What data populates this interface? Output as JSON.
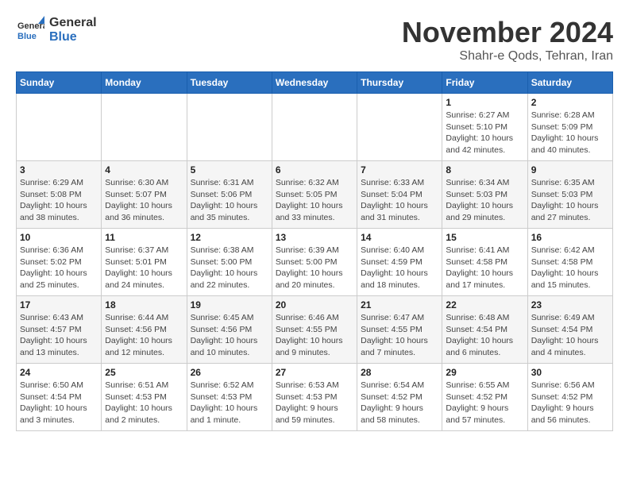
{
  "header": {
    "logo_line1": "General",
    "logo_line2": "Blue",
    "month": "November 2024",
    "location": "Shahr-e Qods, Tehran, Iran"
  },
  "weekdays": [
    "Sunday",
    "Monday",
    "Tuesday",
    "Wednesday",
    "Thursday",
    "Friday",
    "Saturday"
  ],
  "weeks": [
    [
      {
        "day": "",
        "info": ""
      },
      {
        "day": "",
        "info": ""
      },
      {
        "day": "",
        "info": ""
      },
      {
        "day": "",
        "info": ""
      },
      {
        "day": "",
        "info": ""
      },
      {
        "day": "1",
        "info": "Sunrise: 6:27 AM\nSunset: 5:10 PM\nDaylight: 10 hours\nand 42 minutes."
      },
      {
        "day": "2",
        "info": "Sunrise: 6:28 AM\nSunset: 5:09 PM\nDaylight: 10 hours\nand 40 minutes."
      }
    ],
    [
      {
        "day": "3",
        "info": "Sunrise: 6:29 AM\nSunset: 5:08 PM\nDaylight: 10 hours\nand 38 minutes."
      },
      {
        "day": "4",
        "info": "Sunrise: 6:30 AM\nSunset: 5:07 PM\nDaylight: 10 hours\nand 36 minutes."
      },
      {
        "day": "5",
        "info": "Sunrise: 6:31 AM\nSunset: 5:06 PM\nDaylight: 10 hours\nand 35 minutes."
      },
      {
        "day": "6",
        "info": "Sunrise: 6:32 AM\nSunset: 5:05 PM\nDaylight: 10 hours\nand 33 minutes."
      },
      {
        "day": "7",
        "info": "Sunrise: 6:33 AM\nSunset: 5:04 PM\nDaylight: 10 hours\nand 31 minutes."
      },
      {
        "day": "8",
        "info": "Sunrise: 6:34 AM\nSunset: 5:03 PM\nDaylight: 10 hours\nand 29 minutes."
      },
      {
        "day": "9",
        "info": "Sunrise: 6:35 AM\nSunset: 5:03 PM\nDaylight: 10 hours\nand 27 minutes."
      }
    ],
    [
      {
        "day": "10",
        "info": "Sunrise: 6:36 AM\nSunset: 5:02 PM\nDaylight: 10 hours\nand 25 minutes."
      },
      {
        "day": "11",
        "info": "Sunrise: 6:37 AM\nSunset: 5:01 PM\nDaylight: 10 hours\nand 24 minutes."
      },
      {
        "day": "12",
        "info": "Sunrise: 6:38 AM\nSunset: 5:00 PM\nDaylight: 10 hours\nand 22 minutes."
      },
      {
        "day": "13",
        "info": "Sunrise: 6:39 AM\nSunset: 5:00 PM\nDaylight: 10 hours\nand 20 minutes."
      },
      {
        "day": "14",
        "info": "Sunrise: 6:40 AM\nSunset: 4:59 PM\nDaylight: 10 hours\nand 18 minutes."
      },
      {
        "day": "15",
        "info": "Sunrise: 6:41 AM\nSunset: 4:58 PM\nDaylight: 10 hours\nand 17 minutes."
      },
      {
        "day": "16",
        "info": "Sunrise: 6:42 AM\nSunset: 4:58 PM\nDaylight: 10 hours\nand 15 minutes."
      }
    ],
    [
      {
        "day": "17",
        "info": "Sunrise: 6:43 AM\nSunset: 4:57 PM\nDaylight: 10 hours\nand 13 minutes."
      },
      {
        "day": "18",
        "info": "Sunrise: 6:44 AM\nSunset: 4:56 PM\nDaylight: 10 hours\nand 12 minutes."
      },
      {
        "day": "19",
        "info": "Sunrise: 6:45 AM\nSunset: 4:56 PM\nDaylight: 10 hours\nand 10 minutes."
      },
      {
        "day": "20",
        "info": "Sunrise: 6:46 AM\nSunset: 4:55 PM\nDaylight: 10 hours\nand 9 minutes."
      },
      {
        "day": "21",
        "info": "Sunrise: 6:47 AM\nSunset: 4:55 PM\nDaylight: 10 hours\nand 7 minutes."
      },
      {
        "day": "22",
        "info": "Sunrise: 6:48 AM\nSunset: 4:54 PM\nDaylight: 10 hours\nand 6 minutes."
      },
      {
        "day": "23",
        "info": "Sunrise: 6:49 AM\nSunset: 4:54 PM\nDaylight: 10 hours\nand 4 minutes."
      }
    ],
    [
      {
        "day": "24",
        "info": "Sunrise: 6:50 AM\nSunset: 4:54 PM\nDaylight: 10 hours\nand 3 minutes."
      },
      {
        "day": "25",
        "info": "Sunrise: 6:51 AM\nSunset: 4:53 PM\nDaylight: 10 hours\nand 2 minutes."
      },
      {
        "day": "26",
        "info": "Sunrise: 6:52 AM\nSunset: 4:53 PM\nDaylight: 10 hours\nand 1 minute."
      },
      {
        "day": "27",
        "info": "Sunrise: 6:53 AM\nSunset: 4:53 PM\nDaylight: 9 hours\nand 59 minutes."
      },
      {
        "day": "28",
        "info": "Sunrise: 6:54 AM\nSunset: 4:52 PM\nDaylight: 9 hours\nand 58 minutes."
      },
      {
        "day": "29",
        "info": "Sunrise: 6:55 AM\nSunset: 4:52 PM\nDaylight: 9 hours\nand 57 minutes."
      },
      {
        "day": "30",
        "info": "Sunrise: 6:56 AM\nSunset: 4:52 PM\nDaylight: 9 hours\nand 56 minutes."
      }
    ]
  ]
}
